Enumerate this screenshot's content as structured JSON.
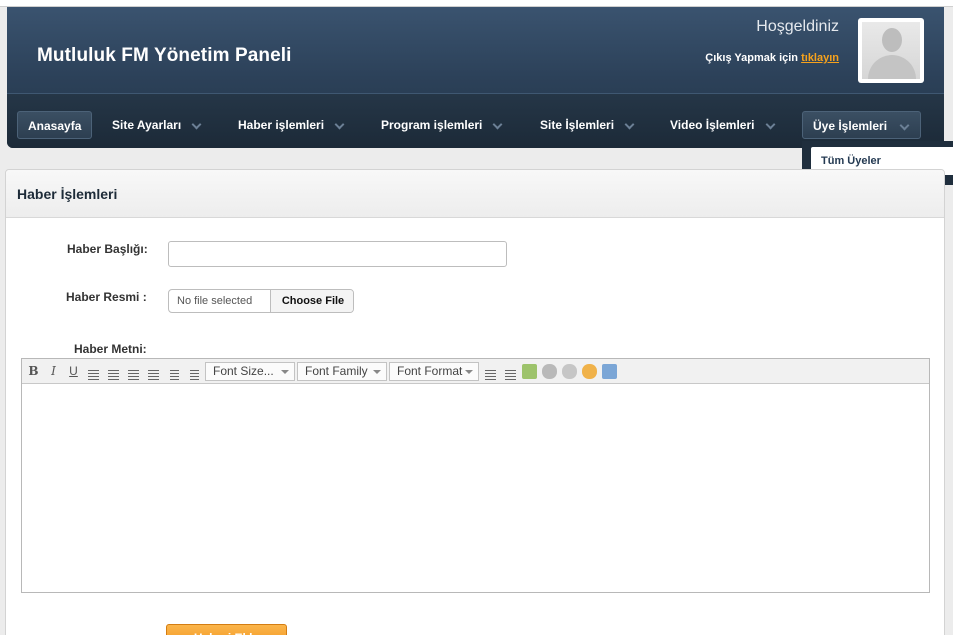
{
  "header": {
    "title": "Mutluluk FM Yönetim Paneli",
    "welcome": "Hoşgeldiniz",
    "logout_text": "Çıkış Yapmak için",
    "logout_link": "tıklayın"
  },
  "nav": {
    "items": [
      {
        "label": "Anasayfa"
      },
      {
        "label": "Site Ayarları"
      },
      {
        "label": "Haber işlemleri"
      },
      {
        "label": "Program işlemleri"
      },
      {
        "label": "Site İşlemleri"
      },
      {
        "label": "Video İşlemleri"
      },
      {
        "label": "Üye İşlemleri"
      }
    ],
    "dropdown": {
      "items": [
        {
          "label": "Tüm Üyeler"
        }
      ]
    }
  },
  "panel": {
    "title": "Haber İşlemleri",
    "fields": {
      "title_label": "Haber Başlığı:",
      "title_value": "",
      "image_label": "Haber Resmi :",
      "file_status": "No file selected",
      "file_button": "Choose File",
      "body_label": "Haber Metni:"
    },
    "editor": {
      "font_size": "Font Size...",
      "font_family": "Font Family",
      "font_format": "Font Format",
      "bold_glyph": "B",
      "italic_glyph": "I",
      "underline_glyph": "U"
    },
    "submit_label": "Haberi Ekle"
  }
}
